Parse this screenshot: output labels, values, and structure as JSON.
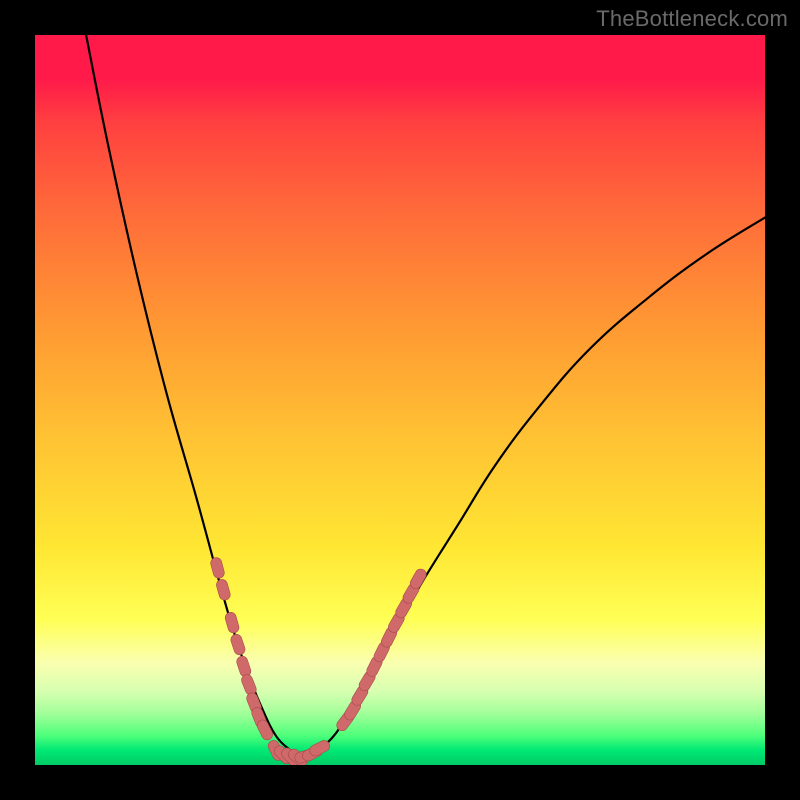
{
  "watermark": "TheBottleneck.com",
  "colors": {
    "page_bg": "#000000",
    "curve": "#000000",
    "marker_fill": "#d06a6a",
    "marker_stroke": "#a84a4a"
  },
  "chart_data": {
    "type": "line",
    "title": "",
    "xlabel": "",
    "ylabel": "",
    "xlim": [
      0,
      100
    ],
    "ylim": [
      0,
      100
    ],
    "grid": false,
    "series": [
      {
        "name": "curve",
        "x": [
          7,
          10,
          14,
          18,
          22,
          25,
          27,
          29,
          31,
          33,
          35,
          36,
          37,
          40,
          43,
          46,
          49,
          53,
          58,
          63,
          69,
          76,
          84,
          92,
          100
        ],
        "y": [
          100,
          85,
          67,
          51,
          37,
          26,
          19,
          13,
          8,
          4,
          2,
          1.2,
          1.5,
          3,
          7,
          12,
          18,
          25,
          33,
          41,
          49,
          57,
          64,
          70,
          75
        ]
      }
    ],
    "markers": [
      {
        "name": "left-dots",
        "x": [
          25.0,
          25.8,
          27.0,
          27.8,
          28.6,
          29.3,
          30.0,
          30.7,
          31.5
        ],
        "y": [
          27.0,
          24.0,
          19.5,
          16.5,
          13.5,
          11.0,
          8.5,
          6.5,
          4.8
        ]
      },
      {
        "name": "bottom-dots",
        "x": [
          33.0,
          34.0,
          35.0,
          36.0,
          37.0,
          38.0,
          39.0
        ],
        "y": [
          2.0,
          1.4,
          1.1,
          1.0,
          1.2,
          1.6,
          2.3
        ]
      },
      {
        "name": "right-dots",
        "x": [
          42.5,
          43.5,
          44.5,
          45.5,
          46.5,
          47.5,
          48.5,
          49.5,
          50.5,
          51.5,
          52.5
        ],
        "y": [
          6.0,
          7.5,
          9.5,
          11.5,
          13.5,
          15.5,
          17.5,
          19.5,
          21.5,
          23.5,
          25.5
        ]
      }
    ]
  }
}
